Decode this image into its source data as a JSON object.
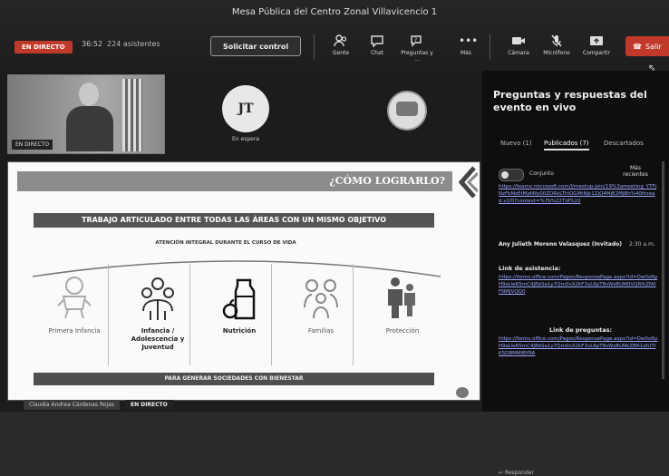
{
  "window": {
    "title": "Mesa Pública del Centro Zonal Villavicencio 1"
  },
  "meeting": {
    "live_badge": "EN DIRECTO",
    "timer": "36:52",
    "attendees": "224 asistentes",
    "control_button": "Solicitar control",
    "leave_button": "Salir"
  },
  "toolbar": [
    {
      "label": "Gente",
      "icon": "people-icon"
    },
    {
      "label": "Chat",
      "icon": "chat-icon"
    },
    {
      "label": "Preguntas y ...",
      "icon": "qa-icon"
    },
    {
      "label": "Más",
      "icon": "more-icon"
    },
    {
      "label": "Cámara",
      "icon": "camera-icon"
    },
    {
      "label": "Micrófono",
      "icon": "mic-icon"
    },
    {
      "label": "Compartir",
      "icon": "share-icon"
    }
  ],
  "participants": {
    "video_badge": "EN DIRECTO",
    "avatar_initials": "JT",
    "avatar_status": "En espera"
  },
  "slide": {
    "header": "¿CÓMO LOGRARLO?",
    "band": "TRABAJO ARTICULADO ENTRE TODAS LAS ÁREAS CON UN MISMO OBJETIVO",
    "subtitle": "ATENCIÓN INTEGRAL DURANTE EL CURSO DE VIDA",
    "items": [
      {
        "label": "Primera Infancia",
        "icon": "baby-icon"
      },
      {
        "label": "Infancia / Adolescencia y Juventud",
        "icon": "youth-group-icon"
      },
      {
        "label": "Nutrición",
        "icon": "nutrition-icon"
      },
      {
        "label": "Familias",
        "icon": "family-icon"
      },
      {
        "label": "Protección",
        "icon": "protection-icon"
      }
    ],
    "footer": "PARA GENERAR SOCIEDADES CON BIENESTAR"
  },
  "presenter": {
    "name": "Claudia Andrea Cárdenas Rojas",
    "live_badge": "EN DIRECTO"
  },
  "qa": {
    "title": "Preguntas y respuestas del evento en vivo",
    "tabs": [
      "Nuevo (1)",
      "Publicados (7)",
      "Descartados"
    ],
    "active_tab": 1,
    "toggle_label": "Conjunto",
    "sort_label": "Más recientes",
    "links_top": "https://teams.microsoft.com/l/meetup-join/19%3ameeting_YTFjNzFkMzEtMjdiNy00ZDRkLThiOGMtNjk1ZjQ4MjE2MjBh%40thread.v2/0?context=%7b%22Tid%22",
    "author": "Any Julieth Moreno Velasquez (Invitado)",
    "time": "2:30 a.m.",
    "section_label": "Link de asistencia:",
    "links_mid": "https://forms.office.com/Pages/ResponsePage.aspx?id=Dw0xRpH9aUeR5mC4J8bSa1y7Qm0nX2kF3vL6pT8sWzBUM0VQRlhZN0FNMjVQQ0",
    "section2_label": "Link de preguntas:",
    "links_bottom": "https://forms.office.com/Pages/ResponsePage.aspx?id=Dw0xRpH9aUeR5mC4J8bSa1y7Qm0nX2kF3vL6pT8sWzBUNkZBR1dIUTlKSDBMMlBYRA",
    "reply_label": "Responder"
  }
}
